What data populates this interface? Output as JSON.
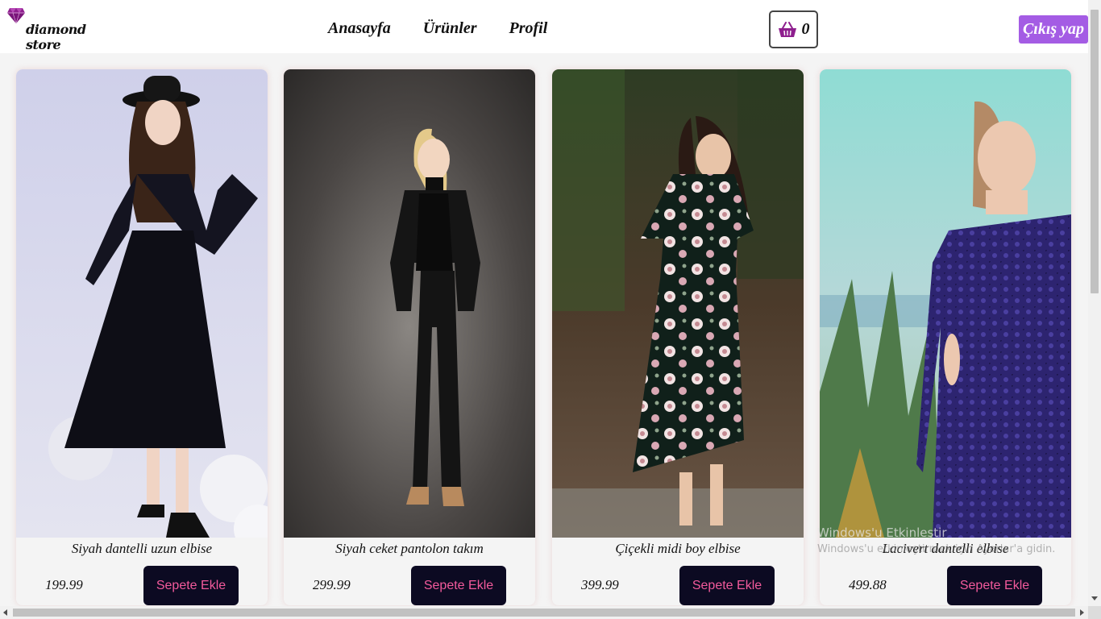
{
  "brand": {
    "name": "diamond store",
    "icon": "diamond-icon",
    "color": "#8e1f8e"
  },
  "nav": {
    "items": [
      "Anasayfa",
      "Ürünler",
      "Profil"
    ]
  },
  "cart": {
    "icon": "shopping-basket-icon",
    "count": "0",
    "icon_color": "#8e1f8e"
  },
  "logout": {
    "label": "Çıkış yap",
    "color": "#a45ce4"
  },
  "products": [
    {
      "name": "Siyah dantelli uzun elbise",
      "price": "199.99",
      "button": "Sepete Ekle"
    },
    {
      "name": "Siyah ceket pantolon takım",
      "price": "299.99",
      "button": "Sepete Ekle"
    },
    {
      "name": "Çiçekli midi boy elbise",
      "price": "399.99",
      "button": "Sepete Ekle"
    },
    {
      "name": "Lacivert dantelli elbise",
      "price": "499.88",
      "button": "Sepete Ekle"
    }
  ],
  "button_colors": {
    "background": "#0c0a22",
    "text": "#f35a9c"
  },
  "watermark": {
    "line1": "Windows'u Etkinleştir",
    "line2": "Windows'u etkinleştirmek için Ayarlar'a gidin."
  }
}
